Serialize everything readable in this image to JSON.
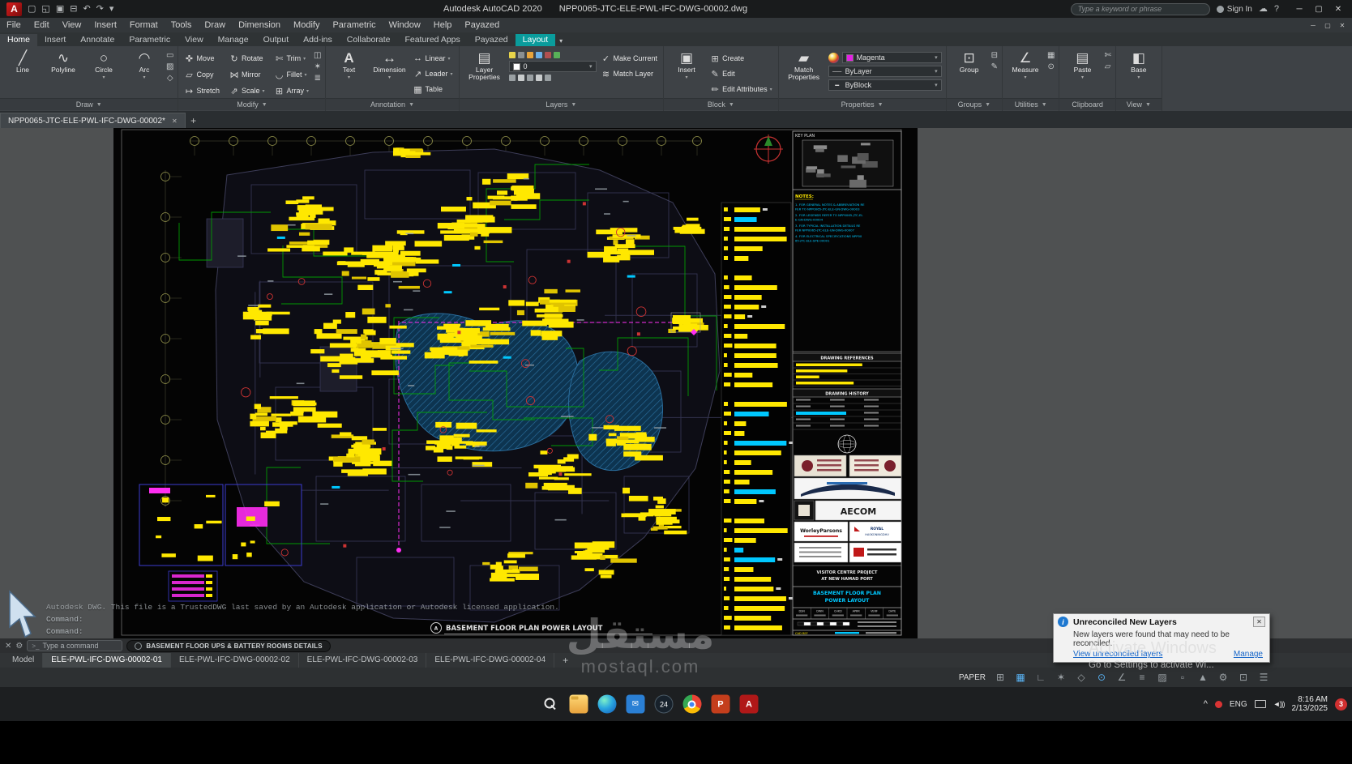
{
  "window": {
    "title": "Autodesk AutoCAD 2020",
    "doc": "NPP0065-JTC-ELE-PWL-IFC-DWG-00002.dwg",
    "search_placeholder": "Type a keyword or phrase",
    "sign_in": "Sign In"
  },
  "qat_icons": [
    "new-file-icon",
    "open-folder-icon",
    "save-icon",
    "plot-icon",
    "undo-icon",
    "redo-icon",
    "qat-customize-caret"
  ],
  "titlebar_icons": [
    "cloud-icon",
    "help-icon"
  ],
  "menu": {
    "items": [
      "File",
      "Edit",
      "View",
      "Insert",
      "Format",
      "Tools",
      "Draw",
      "Dimension",
      "Modify",
      "Parametric",
      "Window",
      "Help",
      "Payazed"
    ]
  },
  "ribbon_tabs": {
    "items": [
      "Home",
      "Insert",
      "Annotate",
      "Parametric",
      "View",
      "Manage",
      "Output",
      "Add-ins",
      "Collaborate",
      "Featured Apps",
      "Payazed",
      "Layout"
    ],
    "active": "Home",
    "contextual": "Layout"
  },
  "ribbon": {
    "draw": {
      "title": "Draw",
      "line": "Line",
      "polyline": "Polyline",
      "circle": "Circle",
      "arc": "Arc"
    },
    "modify": {
      "title": "Modify",
      "items": [
        "Move",
        "Copy",
        "Stretch",
        "Rotate",
        "Mirror",
        "Scale",
        "Trim",
        "Fillet",
        "Array"
      ]
    },
    "annotation": {
      "title": "Annotation",
      "text": "Text",
      "dimension": "Dimension",
      "linear": "Linear",
      "leader": "Leader",
      "table": "Table"
    },
    "layers": {
      "title": "Layers",
      "layer_properties": "Layer Properties",
      "make_current": "Make Current",
      "match_layer": "Match Layer",
      "current_layer": "0"
    },
    "block": {
      "title": "Block",
      "insert": "Insert",
      "create": "Create",
      "edit": "Edit",
      "edit_attributes": "Edit Attributes"
    },
    "properties": {
      "title": "Properties",
      "match_properties": "Match Properties",
      "color": "Magenta",
      "linetype": "ByLayer",
      "lineweight": "ByBlock"
    },
    "groups": {
      "title": "Groups",
      "group": "Group"
    },
    "utilities": {
      "title": "Utilities",
      "measure": "Measure"
    },
    "clipboard": {
      "title": "Clipboard",
      "paste": "Paste"
    },
    "view": {
      "title": "View",
      "base": "Base"
    }
  },
  "file_tabs": {
    "active": "NPP0065-JTC-ELE-PWL-IFC-DWG-00002*"
  },
  "command": {
    "placeholder": "Type a command",
    "history": [
      "Autodesk DWG.  This file is a TrustedDWG last saved by an Autodesk application or Autodesk licensed application.",
      "Command:",
      "Command:"
    ],
    "detail_pill": "BASEMENT FLOOR UPS & BATTERY ROOMS DETAILS"
  },
  "layout_tabs": {
    "items": [
      "Model",
      "ELE-PWL-IFC-DWG-00002-01",
      "ELE-PWL-IFC-DWG-00002-02",
      "ELE-PWL-IFC-DWG-00002-03",
      "ELE-PWL-IFC-DWG-00002-04"
    ],
    "active": "ELE-PWL-IFC-DWG-00002-01"
  },
  "status": {
    "space": "PAPER",
    "icons": [
      "grid-icon",
      "snap-icon",
      "ortho-icon",
      "polar-icon",
      "isodraft-icon",
      "osnap-icon",
      "otrack-icon",
      "lineweight-icon",
      "transparency-icon",
      "selection-icon",
      "annotation-icon",
      "workspace-icon",
      "clean-screen-icon",
      "customize-icon"
    ]
  },
  "notification": {
    "title": "Unreconciled New Layers",
    "body": "New layers were found that may need to be reconciled.",
    "link": "View unreconciled layers",
    "manage": "Manage"
  },
  "activate": {
    "line1": "Activate Windows",
    "line2": "Go to Settings to activate Wi..."
  },
  "site_watermark": {
    "arabic": "مستقل",
    "latin": "mostaql.com"
  },
  "taskbar": {
    "icons": [
      {
        "name": "start"
      },
      {
        "name": "search"
      },
      {
        "name": "file-explorer"
      },
      {
        "name": "edge"
      },
      {
        "name": "mail",
        "glyph": "✉"
      },
      {
        "name": "app-badge",
        "label": "24"
      },
      {
        "name": "chrome"
      },
      {
        "name": "powerpoint",
        "glyph": "P"
      },
      {
        "name": "autocad",
        "glyph": "A"
      }
    ]
  },
  "tray": {
    "lang": "ENG",
    "time": "8:16 AM",
    "date": "2/13/2025",
    "badge": "3"
  },
  "drawing": {
    "plan_title": "BASEMENT FLOOR PLAN POWER LAYOUT",
    "colors": {
      "yellow": "#ffe800",
      "magenta": "#ff2ef2",
      "green": "#00a800",
      "cyan": "#00c8ff",
      "pool_fill": "#0d3450",
      "pool_line": "#2a6e9e"
    },
    "seed": 20250213,
    "titleblock": {
      "key_plan": "KEY PLAN",
      "notes_title": "NOTES:",
      "notes": [
        "1. FOR GENERAL NOTES & ABBREVIATION REFER TO NPP0065-JTC-ELE-GN-DWG-00003",
        "2. FOR LEGENDS REFER TO NPP0065-JTC-ELE-GN-DWG-00004",
        "3. FOR TYPICAL INSTALLATION DETAILS REFER NPP0065-JTC-ELE-GN-DWG-00007",
        "4. FOR ELECTRICAL SPECIFICATIONS NPP0065-JTC-ELE-SPE-00001"
      ],
      "drawing_references": "DRAWING REFERENCES",
      "drawing_history": "DRAWING HISTORY",
      "logo_aecom": "AECOM",
      "logo_worley": "WorleyParsons",
      "logo_royal_1": "ROYAL",
      "logo_royal_2": "HASKONINGDHV",
      "project_1": "VISITOR CENTRE PROJECT",
      "project_2": "AT NEW HAMAD PORT",
      "sheet_title_1": "BASEMENT FLOOR PLAN",
      "sheet_title_2": "POWER LAYOUT",
      "approval_cols": [
        "DSN",
        "DWN",
        "CHKD",
        "APRR",
        "VERF",
        "DATE"
      ],
      "cad_ref": "CAD REF"
    }
  }
}
